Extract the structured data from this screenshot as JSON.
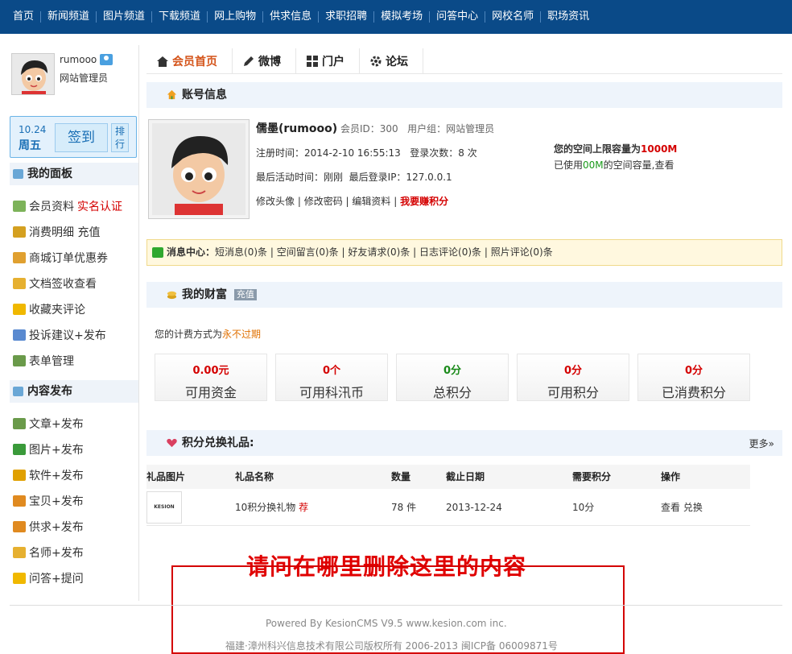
{
  "topnav": [
    "首页",
    "新闻频道",
    "图片频道",
    "下载频道",
    "网上购物",
    "供求信息",
    "求职招聘",
    "模拟考场",
    "问答中心",
    "网校名师",
    "职场资讯"
  ],
  "user": {
    "name": "rumooo",
    "role": "网站管理员"
  },
  "sign": {
    "date": "10.24",
    "weekday": "周五",
    "button": "签到",
    "rank": "排行"
  },
  "panel": {
    "title": "我的面板",
    "items": [
      {
        "label": "会员资料",
        "extra": "实名认证",
        "icon": "profile-icon",
        "color": "#7db35a"
      },
      {
        "label": "消费明细 充值",
        "icon": "coins-icon",
        "color": "#d4a020"
      },
      {
        "label": "商城订单优惠券",
        "icon": "order-icon",
        "color": "#e0a030"
      },
      {
        "label": "文档签收查看",
        "icon": "folder-icon",
        "color": "#e6b030"
      },
      {
        "label": "收藏夹评论",
        "icon": "star-icon",
        "color": "#f0b800"
      },
      {
        "label": "投诉建议+发布",
        "icon": "document-icon",
        "color": "#5a8ad0"
      },
      {
        "label": "表单管理",
        "icon": "edit-form-icon",
        "color": "#6a9a4a"
      }
    ]
  },
  "content": {
    "title": "内容发布",
    "items": [
      {
        "label": "文章+发布",
        "icon": "article-icon",
        "color": "#6a9a4a"
      },
      {
        "label": "图片+发布",
        "icon": "image-icon",
        "color": "#3a9a3a"
      },
      {
        "label": "软件+发布",
        "icon": "software-icon",
        "color": "#e0a000"
      },
      {
        "label": "宝贝+发布",
        "icon": "product-icon",
        "color": "#e08a20"
      },
      {
        "label": "供求+发布",
        "icon": "supply-icon",
        "color": "#e08a20"
      },
      {
        "label": "名师+发布",
        "icon": "teacher-icon",
        "color": "#e6b030"
      },
      {
        "label": "问答+提问",
        "icon": "question-icon",
        "color": "#f0b800"
      }
    ]
  },
  "tabs": [
    {
      "label": "会员首页",
      "icon": "home-icon"
    },
    {
      "label": "微博",
      "icon": "pencil-icon"
    },
    {
      "label": "门户",
      "icon": "grid-icon"
    },
    {
      "label": "论坛",
      "icon": "gear-icon"
    }
  ],
  "account": {
    "title": "账号信息",
    "name": "儒墨(rumooo)",
    "member_id": "会员ID：300",
    "group": "用户组：网站管理员",
    "register": "注册时间：2014-2-10 16:55:13",
    "logins": "登录次数：8 次",
    "last_active": "最后活动时间：刚刚",
    "last_ip": "最后登录IP：127.0.0.1",
    "links": [
      "修改头像",
      "修改密码",
      "编辑资料"
    ],
    "earn": "我要赚积分",
    "space_limit_prefix": "您的空间上限容量为",
    "space_limit": "1000M",
    "space_used_prefix": "已使用",
    "space_used": "00M",
    "space_used_suffix": "的空间容量,查看"
  },
  "messages": {
    "label": "消息中心：",
    "items": [
      "短消息(0)条",
      "空间留言(0)条",
      "好友请求(0)条",
      "日志评论(0)条",
      "照片评论(0)条"
    ]
  },
  "wealth": {
    "title": "我的财富",
    "recharge": "充值",
    "billing_prefix": "您的计费方式为",
    "billing": "永不过期",
    "stats": [
      {
        "value": "0.00元",
        "label": "可用资金",
        "color": "red"
      },
      {
        "value": "0个",
        "label": "可用科汛币",
        "color": "red"
      },
      {
        "value": "0分",
        "label": "总积分",
        "color": "green"
      },
      {
        "value": "0分",
        "label": "可用积分",
        "color": "red"
      },
      {
        "value": "0分",
        "label": "已消费积分",
        "color": "red"
      }
    ]
  },
  "gifts": {
    "title": "积分兑换礼品:",
    "more": "更多»",
    "headers": [
      "礼品图片",
      "礼品名称",
      "数量",
      "截止日期",
      "需要积分",
      "操作"
    ],
    "rows": [
      {
        "thumb": "KESION",
        "name": "10积分换礼物",
        "tag": "荐",
        "qty": "78 件",
        "deadline": "2013-12-24",
        "points": "10分",
        "actions": [
          "查看",
          "兑换"
        ]
      }
    ]
  },
  "annotation": "请问在哪里删除这里的内容",
  "footer": {
    "powered": "Powered By KesionCMS V9.5  www.kesion.com  inc.",
    "copyright": "福建·漳州科兴信息技术有限公司版权所有 2006-2013 闽ICP备 06009871号"
  }
}
